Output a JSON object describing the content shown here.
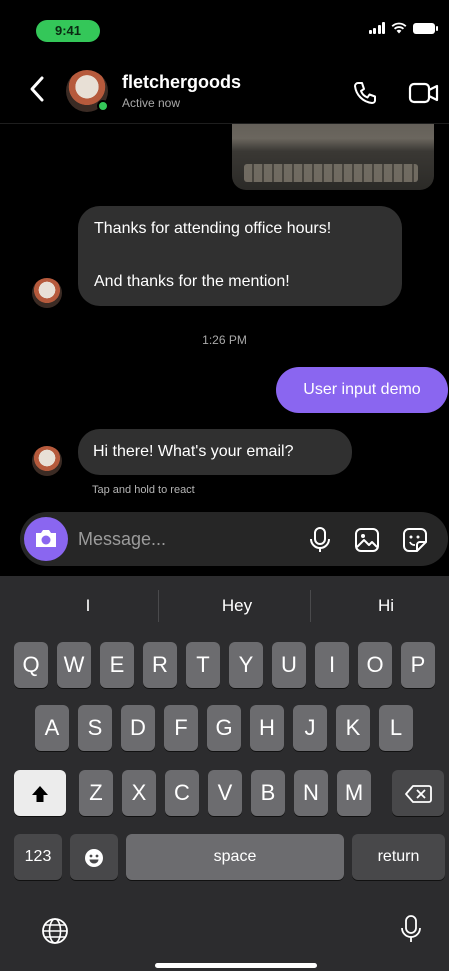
{
  "status_bar": {
    "time": "9:41"
  },
  "header": {
    "username": "fletchergoods",
    "status": "Active now",
    "icons": {
      "back": "chevron-left-icon",
      "call": "phone-icon",
      "video": "video-camera-icon"
    }
  },
  "messages": {
    "received_1_line1": "Thanks for attending office hours!",
    "received_1_line2": "And thanks for the mention!",
    "timestamp": "1:26 PM",
    "sent_1": "User input demo",
    "received_2": "Hi there! What's your email?",
    "react_hint": "Tap and hold to react"
  },
  "composer": {
    "placeholder": "Message...",
    "icons": {
      "camera": "camera-icon",
      "mic": "microphone-icon",
      "gallery": "image-icon",
      "sticker": "sticker-icon"
    }
  },
  "keyboard": {
    "suggestions": [
      "I",
      "Hey",
      "Hi"
    ],
    "row1": [
      "Q",
      "W",
      "E",
      "R",
      "T",
      "Y",
      "U",
      "I",
      "O",
      "P"
    ],
    "row2": [
      "A",
      "S",
      "D",
      "F",
      "G",
      "H",
      "J",
      "K",
      "L"
    ],
    "row3": [
      "Z",
      "X",
      "C",
      "V",
      "B",
      "N",
      "M"
    ],
    "numbers_label": "123",
    "space_label": "space",
    "return_label": "return",
    "colors": {
      "accent": "#8a66f0",
      "online": "#34c759"
    }
  }
}
